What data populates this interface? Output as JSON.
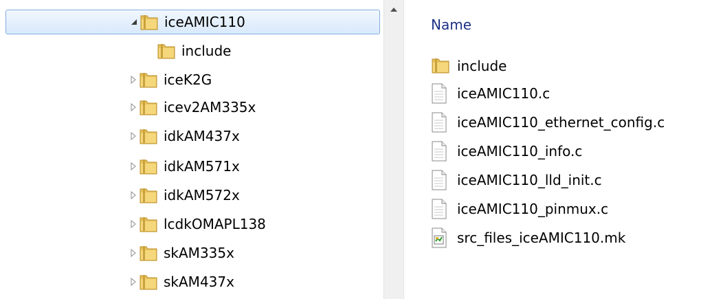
{
  "tree": {
    "items": [
      {
        "label": "iceAMIC110",
        "expanded": true,
        "selected": true
      },
      {
        "label": "include",
        "child": true
      },
      {
        "label": "iceK2G"
      },
      {
        "label": "icev2AM335x"
      },
      {
        "label": "idkAM437x"
      },
      {
        "label": "idkAM571x"
      },
      {
        "label": "idkAM572x"
      },
      {
        "label": "lcdkOMAPL138"
      },
      {
        "label": "skAM335x"
      },
      {
        "label": "skAM437x"
      }
    ]
  },
  "list": {
    "column_name": "Name",
    "items": [
      {
        "label": "include",
        "icon": "folder-icon"
      },
      {
        "label": "iceAMIC110.c",
        "icon": "file-icon"
      },
      {
        "label": "iceAMIC110_ethernet_config.c",
        "icon": "file-icon"
      },
      {
        "label": "iceAMIC110_info.c",
        "icon": "file-icon"
      },
      {
        "label": "iceAMIC110_lld_init.c",
        "icon": "file-icon"
      },
      {
        "label": "iceAMIC110_pinmux.c",
        "icon": "file-icon"
      },
      {
        "label": "src_files_iceAMIC110.mk",
        "icon": "makefile-icon"
      }
    ]
  },
  "colors": {
    "selection_fill": "#d9e9fc",
    "selection_border": "#84acdd",
    "folder": "#e8c25a",
    "header_text": "#1e3287"
  }
}
